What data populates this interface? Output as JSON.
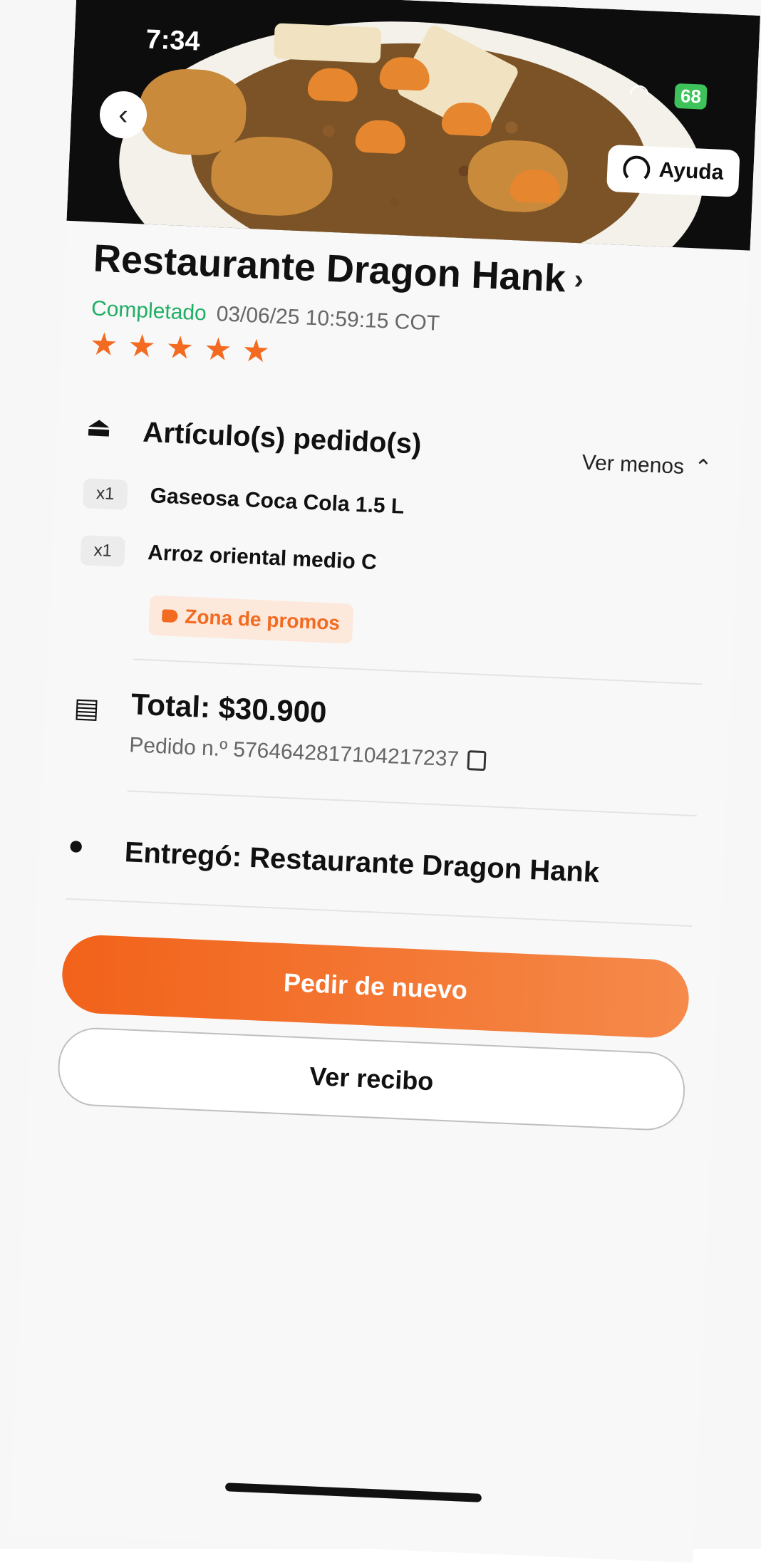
{
  "status_bar": {
    "time": "7:34",
    "battery": "68"
  },
  "header": {
    "help_label": "Ayuda"
  },
  "restaurant": {
    "name": "Restaurante Dragon Hank",
    "status": "Completado",
    "datetime": "03/06/25 10:59:15 COT",
    "rating": 5
  },
  "items_section": {
    "title": "Artículo(s) pedido(s)",
    "toggle_label": "Ver menos",
    "items": [
      {
        "qty": "x1",
        "name": "Gaseosa Coca Cola 1.5 L"
      },
      {
        "qty": "x1",
        "name": "Arroz oriental medio C"
      }
    ],
    "promo_label": "Zona de promos"
  },
  "order": {
    "total": "Total: $30.900",
    "order_number": "Pedido n.º 5764642817104217237"
  },
  "delivery": {
    "delivered_by": "Entregó: Restaurante Dragon Hank"
  },
  "actions": {
    "reorder_label": "Pedir de nuevo",
    "receipt_label": "Ver recibo"
  },
  "colors": {
    "accent": "#f26b21",
    "completed": "#1fae63"
  }
}
